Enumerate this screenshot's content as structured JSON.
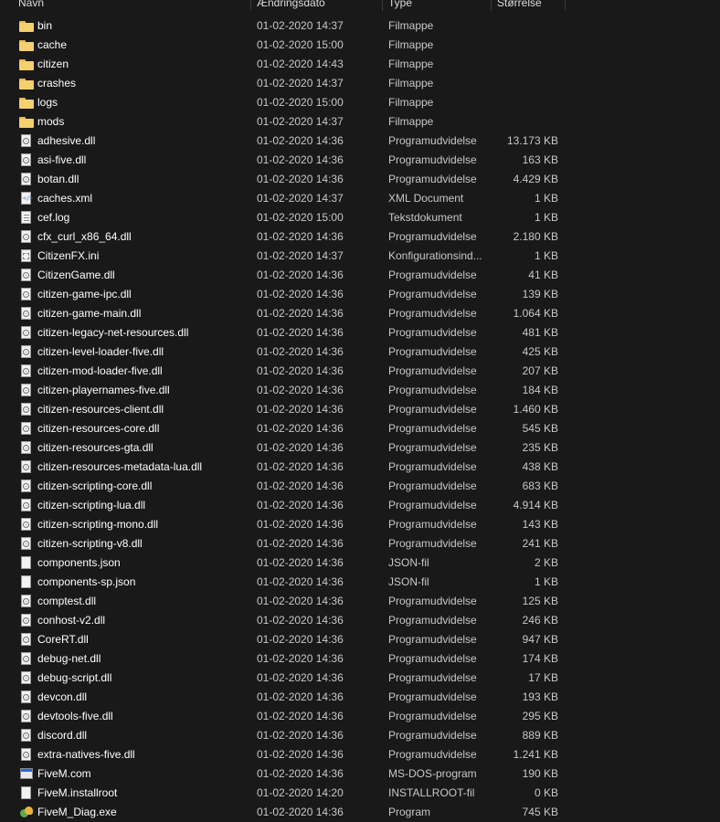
{
  "columns": {
    "name": "Navn",
    "date": "Ændringsdato",
    "type": "Type",
    "size": "Størrelse"
  },
  "files": [
    {
      "name": "bin",
      "date": "01-02-2020 14:37",
      "type": "Filmappe",
      "size": "",
      "icon": "folder-icon"
    },
    {
      "name": "cache",
      "date": "01-02-2020 15:00",
      "type": "Filmappe",
      "size": "",
      "icon": "folder-icon"
    },
    {
      "name": "citizen",
      "date": "01-02-2020 14:43",
      "type": "Filmappe",
      "size": "",
      "icon": "folder-icon"
    },
    {
      "name": "crashes",
      "date": "01-02-2020 14:37",
      "type": "Filmappe",
      "size": "",
      "icon": "folder-icon"
    },
    {
      "name": "logs",
      "date": "01-02-2020 15:00",
      "type": "Filmappe",
      "size": "",
      "icon": "folder-icon"
    },
    {
      "name": "mods",
      "date": "01-02-2020 14:37",
      "type": "Filmappe",
      "size": "",
      "icon": "folder-icon"
    },
    {
      "name": "adhesive.dll",
      "date": "01-02-2020 14:36",
      "type": "Programudvidelse",
      "size": "13.173 KB",
      "icon": "dll-icon"
    },
    {
      "name": "asi-five.dll",
      "date": "01-02-2020 14:36",
      "type": "Programudvidelse",
      "size": "163 KB",
      "icon": "dll-icon"
    },
    {
      "name": "botan.dll",
      "date": "01-02-2020 14:36",
      "type": "Programudvidelse",
      "size": "4.429 KB",
      "icon": "dll-icon"
    },
    {
      "name": "caches.xml",
      "date": "01-02-2020 14:37",
      "type": "XML Document",
      "size": "1 KB",
      "icon": "xml-icon"
    },
    {
      "name": "cef.log",
      "date": "01-02-2020 15:00",
      "type": "Tekstdokument",
      "size": "1 KB",
      "icon": "text-icon"
    },
    {
      "name": "cfx_curl_x86_64.dll",
      "date": "01-02-2020 14:36",
      "type": "Programudvidelse",
      "size": "2.180 KB",
      "icon": "dll-icon"
    },
    {
      "name": "CitizenFX.ini",
      "date": "01-02-2020 14:37",
      "type": "Konfigurationsind...",
      "size": "1 KB",
      "icon": "ini-icon"
    },
    {
      "name": "CitizenGame.dll",
      "date": "01-02-2020 14:36",
      "type": "Programudvidelse",
      "size": "41 KB",
      "icon": "dll-icon"
    },
    {
      "name": "citizen-game-ipc.dll",
      "date": "01-02-2020 14:36",
      "type": "Programudvidelse",
      "size": "139 KB",
      "icon": "dll-icon"
    },
    {
      "name": "citizen-game-main.dll",
      "date": "01-02-2020 14:36",
      "type": "Programudvidelse",
      "size": "1.064 KB",
      "icon": "dll-icon"
    },
    {
      "name": "citizen-legacy-net-resources.dll",
      "date": "01-02-2020 14:36",
      "type": "Programudvidelse",
      "size": "481 KB",
      "icon": "dll-icon"
    },
    {
      "name": "citizen-level-loader-five.dll",
      "date": "01-02-2020 14:36",
      "type": "Programudvidelse",
      "size": "425 KB",
      "icon": "dll-icon"
    },
    {
      "name": "citizen-mod-loader-five.dll",
      "date": "01-02-2020 14:36",
      "type": "Programudvidelse",
      "size": "207 KB",
      "icon": "dll-icon"
    },
    {
      "name": "citizen-playernames-five.dll",
      "date": "01-02-2020 14:36",
      "type": "Programudvidelse",
      "size": "184 KB",
      "icon": "dll-icon"
    },
    {
      "name": "citizen-resources-client.dll",
      "date": "01-02-2020 14:36",
      "type": "Programudvidelse",
      "size": "1.460 KB",
      "icon": "dll-icon"
    },
    {
      "name": "citizen-resources-core.dll",
      "date": "01-02-2020 14:36",
      "type": "Programudvidelse",
      "size": "545 KB",
      "icon": "dll-icon"
    },
    {
      "name": "citizen-resources-gta.dll",
      "date": "01-02-2020 14:36",
      "type": "Programudvidelse",
      "size": "235 KB",
      "icon": "dll-icon"
    },
    {
      "name": "citizen-resources-metadata-lua.dll",
      "date": "01-02-2020 14:36",
      "type": "Programudvidelse",
      "size": "438 KB",
      "icon": "dll-icon"
    },
    {
      "name": "citizen-scripting-core.dll",
      "date": "01-02-2020 14:36",
      "type": "Programudvidelse",
      "size": "683 KB",
      "icon": "dll-icon"
    },
    {
      "name": "citizen-scripting-lua.dll",
      "date": "01-02-2020 14:36",
      "type": "Programudvidelse",
      "size": "4.914 KB",
      "icon": "dll-icon"
    },
    {
      "name": "citizen-scripting-mono.dll",
      "date": "01-02-2020 14:36",
      "type": "Programudvidelse",
      "size": "143 KB",
      "icon": "dll-icon"
    },
    {
      "name": "citizen-scripting-v8.dll",
      "date": "01-02-2020 14:36",
      "type": "Programudvidelse",
      "size": "241 KB",
      "icon": "dll-icon"
    },
    {
      "name": "components.json",
      "date": "01-02-2020 14:36",
      "type": "JSON-fil",
      "size": "2 KB",
      "icon": "file-icon"
    },
    {
      "name": "components-sp.json",
      "date": "01-02-2020 14:36",
      "type": "JSON-fil",
      "size": "1 KB",
      "icon": "file-icon"
    },
    {
      "name": "comptest.dll",
      "date": "01-02-2020 14:36",
      "type": "Programudvidelse",
      "size": "125 KB",
      "icon": "dll-icon"
    },
    {
      "name": "conhost-v2.dll",
      "date": "01-02-2020 14:36",
      "type": "Programudvidelse",
      "size": "246 KB",
      "icon": "dll-icon"
    },
    {
      "name": "CoreRT.dll",
      "date": "01-02-2020 14:36",
      "type": "Programudvidelse",
      "size": "947 KB",
      "icon": "dll-icon"
    },
    {
      "name": "debug-net.dll",
      "date": "01-02-2020 14:36",
      "type": "Programudvidelse",
      "size": "174 KB",
      "icon": "dll-icon"
    },
    {
      "name": "debug-script.dll",
      "date": "01-02-2020 14:36",
      "type": "Programudvidelse",
      "size": "17 KB",
      "icon": "dll-icon"
    },
    {
      "name": "devcon.dll",
      "date": "01-02-2020 14:36",
      "type": "Programudvidelse",
      "size": "193 KB",
      "icon": "dll-icon"
    },
    {
      "name": "devtools-five.dll",
      "date": "01-02-2020 14:36",
      "type": "Programudvidelse",
      "size": "295 KB",
      "icon": "dll-icon"
    },
    {
      "name": "discord.dll",
      "date": "01-02-2020 14:36",
      "type": "Programudvidelse",
      "size": "889 KB",
      "icon": "dll-icon"
    },
    {
      "name": "extra-natives-five.dll",
      "date": "01-02-2020 14:36",
      "type": "Programudvidelse",
      "size": "1.241 KB",
      "icon": "dll-icon"
    },
    {
      "name": "FiveM.com",
      "date": "01-02-2020 14:36",
      "type": "MS-DOS-program",
      "size": "190 KB",
      "icon": "msdos-icon"
    },
    {
      "name": "FiveM.installroot",
      "date": "01-02-2020 14:20",
      "type": "INSTALLROOT-fil",
      "size": "0 KB",
      "icon": "file-icon"
    },
    {
      "name": "FiveM_Diag.exe",
      "date": "01-02-2020 14:36",
      "type": "Program",
      "size": "745 KB",
      "icon": "exe-icon"
    }
  ]
}
